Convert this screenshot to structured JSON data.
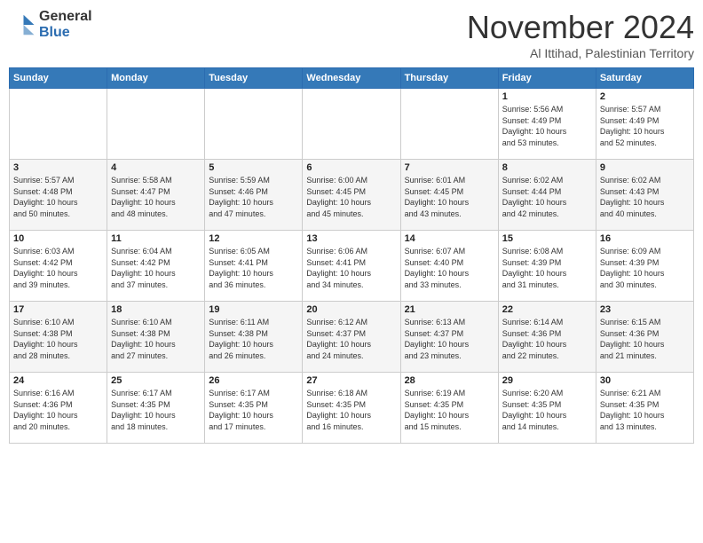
{
  "logo": {
    "general": "General",
    "blue": "Blue"
  },
  "header": {
    "month": "November 2024",
    "location": "Al Ittihad, Palestinian Territory"
  },
  "weekdays": [
    "Sunday",
    "Monday",
    "Tuesday",
    "Wednesday",
    "Thursday",
    "Friday",
    "Saturday"
  ],
  "weeks": [
    [
      {
        "day": "",
        "info": ""
      },
      {
        "day": "",
        "info": ""
      },
      {
        "day": "",
        "info": ""
      },
      {
        "day": "",
        "info": ""
      },
      {
        "day": "",
        "info": ""
      },
      {
        "day": "1",
        "info": "Sunrise: 5:56 AM\nSunset: 4:49 PM\nDaylight: 10 hours\nand 53 minutes."
      },
      {
        "day": "2",
        "info": "Sunrise: 5:57 AM\nSunset: 4:49 PM\nDaylight: 10 hours\nand 52 minutes."
      }
    ],
    [
      {
        "day": "3",
        "info": "Sunrise: 5:57 AM\nSunset: 4:48 PM\nDaylight: 10 hours\nand 50 minutes."
      },
      {
        "day": "4",
        "info": "Sunrise: 5:58 AM\nSunset: 4:47 PM\nDaylight: 10 hours\nand 48 minutes."
      },
      {
        "day": "5",
        "info": "Sunrise: 5:59 AM\nSunset: 4:46 PM\nDaylight: 10 hours\nand 47 minutes."
      },
      {
        "day": "6",
        "info": "Sunrise: 6:00 AM\nSunset: 4:45 PM\nDaylight: 10 hours\nand 45 minutes."
      },
      {
        "day": "7",
        "info": "Sunrise: 6:01 AM\nSunset: 4:45 PM\nDaylight: 10 hours\nand 43 minutes."
      },
      {
        "day": "8",
        "info": "Sunrise: 6:02 AM\nSunset: 4:44 PM\nDaylight: 10 hours\nand 42 minutes."
      },
      {
        "day": "9",
        "info": "Sunrise: 6:02 AM\nSunset: 4:43 PM\nDaylight: 10 hours\nand 40 minutes."
      }
    ],
    [
      {
        "day": "10",
        "info": "Sunrise: 6:03 AM\nSunset: 4:42 PM\nDaylight: 10 hours\nand 39 minutes."
      },
      {
        "day": "11",
        "info": "Sunrise: 6:04 AM\nSunset: 4:42 PM\nDaylight: 10 hours\nand 37 minutes."
      },
      {
        "day": "12",
        "info": "Sunrise: 6:05 AM\nSunset: 4:41 PM\nDaylight: 10 hours\nand 36 minutes."
      },
      {
        "day": "13",
        "info": "Sunrise: 6:06 AM\nSunset: 4:41 PM\nDaylight: 10 hours\nand 34 minutes."
      },
      {
        "day": "14",
        "info": "Sunrise: 6:07 AM\nSunset: 4:40 PM\nDaylight: 10 hours\nand 33 minutes."
      },
      {
        "day": "15",
        "info": "Sunrise: 6:08 AM\nSunset: 4:39 PM\nDaylight: 10 hours\nand 31 minutes."
      },
      {
        "day": "16",
        "info": "Sunrise: 6:09 AM\nSunset: 4:39 PM\nDaylight: 10 hours\nand 30 minutes."
      }
    ],
    [
      {
        "day": "17",
        "info": "Sunrise: 6:10 AM\nSunset: 4:38 PM\nDaylight: 10 hours\nand 28 minutes."
      },
      {
        "day": "18",
        "info": "Sunrise: 6:10 AM\nSunset: 4:38 PM\nDaylight: 10 hours\nand 27 minutes."
      },
      {
        "day": "19",
        "info": "Sunrise: 6:11 AM\nSunset: 4:38 PM\nDaylight: 10 hours\nand 26 minutes."
      },
      {
        "day": "20",
        "info": "Sunrise: 6:12 AM\nSunset: 4:37 PM\nDaylight: 10 hours\nand 24 minutes."
      },
      {
        "day": "21",
        "info": "Sunrise: 6:13 AM\nSunset: 4:37 PM\nDaylight: 10 hours\nand 23 minutes."
      },
      {
        "day": "22",
        "info": "Sunrise: 6:14 AM\nSunset: 4:36 PM\nDaylight: 10 hours\nand 22 minutes."
      },
      {
        "day": "23",
        "info": "Sunrise: 6:15 AM\nSunset: 4:36 PM\nDaylight: 10 hours\nand 21 minutes."
      }
    ],
    [
      {
        "day": "24",
        "info": "Sunrise: 6:16 AM\nSunset: 4:36 PM\nDaylight: 10 hours\nand 20 minutes."
      },
      {
        "day": "25",
        "info": "Sunrise: 6:17 AM\nSunset: 4:35 PM\nDaylight: 10 hours\nand 18 minutes."
      },
      {
        "day": "26",
        "info": "Sunrise: 6:17 AM\nSunset: 4:35 PM\nDaylight: 10 hours\nand 17 minutes."
      },
      {
        "day": "27",
        "info": "Sunrise: 6:18 AM\nSunset: 4:35 PM\nDaylight: 10 hours\nand 16 minutes."
      },
      {
        "day": "28",
        "info": "Sunrise: 6:19 AM\nSunset: 4:35 PM\nDaylight: 10 hours\nand 15 minutes."
      },
      {
        "day": "29",
        "info": "Sunrise: 6:20 AM\nSunset: 4:35 PM\nDaylight: 10 hours\nand 14 minutes."
      },
      {
        "day": "30",
        "info": "Sunrise: 6:21 AM\nSunset: 4:35 PM\nDaylight: 10 hours\nand 13 minutes."
      }
    ]
  ]
}
